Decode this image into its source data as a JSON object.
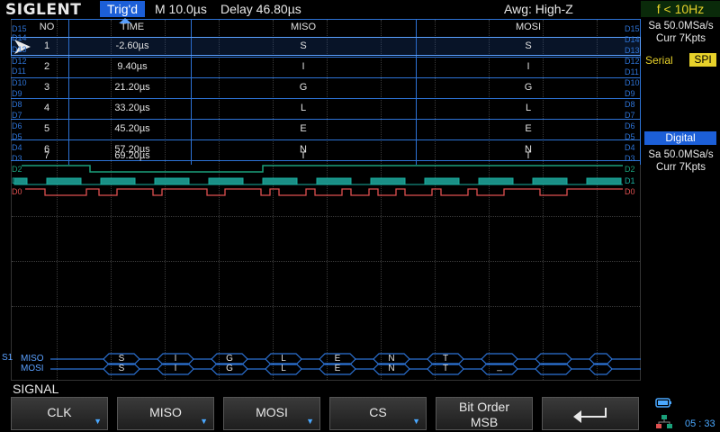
{
  "header": {
    "logo": "SIGLENT",
    "trig_status": "Trig'd",
    "timebase": "M 10.0µs",
    "delay": "Delay 46.80µs",
    "awg": "Awg: High-Z",
    "freq": "f < 10Hz"
  },
  "table": {
    "columns": [
      "NO",
      "TIME",
      "MISO",
      "MOSI"
    ],
    "rows": [
      {
        "no": "1",
        "time": "-2.60µs",
        "miso": "S",
        "mosi": "S"
      },
      {
        "no": "2",
        "time": "9.40µs",
        "miso": "I",
        "mosi": "I"
      },
      {
        "no": "3",
        "time": "21.20µs",
        "miso": "G",
        "mosi": "G"
      },
      {
        "no": "4",
        "time": "33.20µs",
        "miso": "L",
        "mosi": "L"
      },
      {
        "no": "5",
        "time": "45.20µs",
        "miso": "E",
        "mosi": "E"
      },
      {
        "no": "6",
        "time": "57.20µs",
        "miso": "N",
        "mosi": "N"
      },
      {
        "no": "7",
        "time": "69.20µs",
        "miso": "T",
        "mosi": "T"
      }
    ],
    "left_labels": [
      "D15",
      "D14",
      "D13",
      "D12",
      "D11",
      "D10",
      "D9",
      "D8",
      "D7",
      "D6",
      "D5",
      "D4",
      "D3"
    ],
    "right_labels": [
      "D15",
      "D14",
      "D13",
      "D12",
      "D11",
      "D10",
      "D9",
      "D8",
      "D7",
      "D6",
      "D5",
      "D4",
      "D3"
    ]
  },
  "channels": {
    "d2": "D2",
    "d1": "D1",
    "d0": "D0",
    "d2_right": "D2",
    "d1_right": "D1",
    "d0_right": "D0"
  },
  "decode": {
    "bus_marker": "S1",
    "miso_label": "MISO",
    "mosi_label": "MOSI",
    "miso_values": [
      "S",
      "I",
      "G",
      "L",
      "E",
      "N",
      "T",
      "",
      ""
    ],
    "mosi_values": [
      "S",
      "I",
      "G",
      "L",
      "E",
      "N",
      "T",
      "_",
      ""
    ]
  },
  "right_panel": {
    "sa1": "Sa 50.0MSa/s",
    "curr1": "Curr 7Kpts",
    "serial_label": "Serial",
    "spi_badge": "SPI",
    "digital_badge": "Digital",
    "sa2": "Sa 50.0MSa/s",
    "curr2": "Curr 7Kpts"
  },
  "signal_label": "SIGNAL",
  "softkeys": {
    "clk": "CLK",
    "miso": "MISO",
    "mosi": "MOSI",
    "cs": "CS",
    "bit_order_line1": "Bit Order",
    "bit_order_line2": "MSB",
    "back_glyph": "⮐"
  },
  "status": {
    "clock": "05 : 33"
  },
  "colors": {
    "accent": "#1c5fd8",
    "grid": "#2d73d6",
    "d2": "#1aa07a",
    "d1": "#1ab0a0",
    "d0": "#e05050",
    "yellow": "#e8d22a"
  }
}
